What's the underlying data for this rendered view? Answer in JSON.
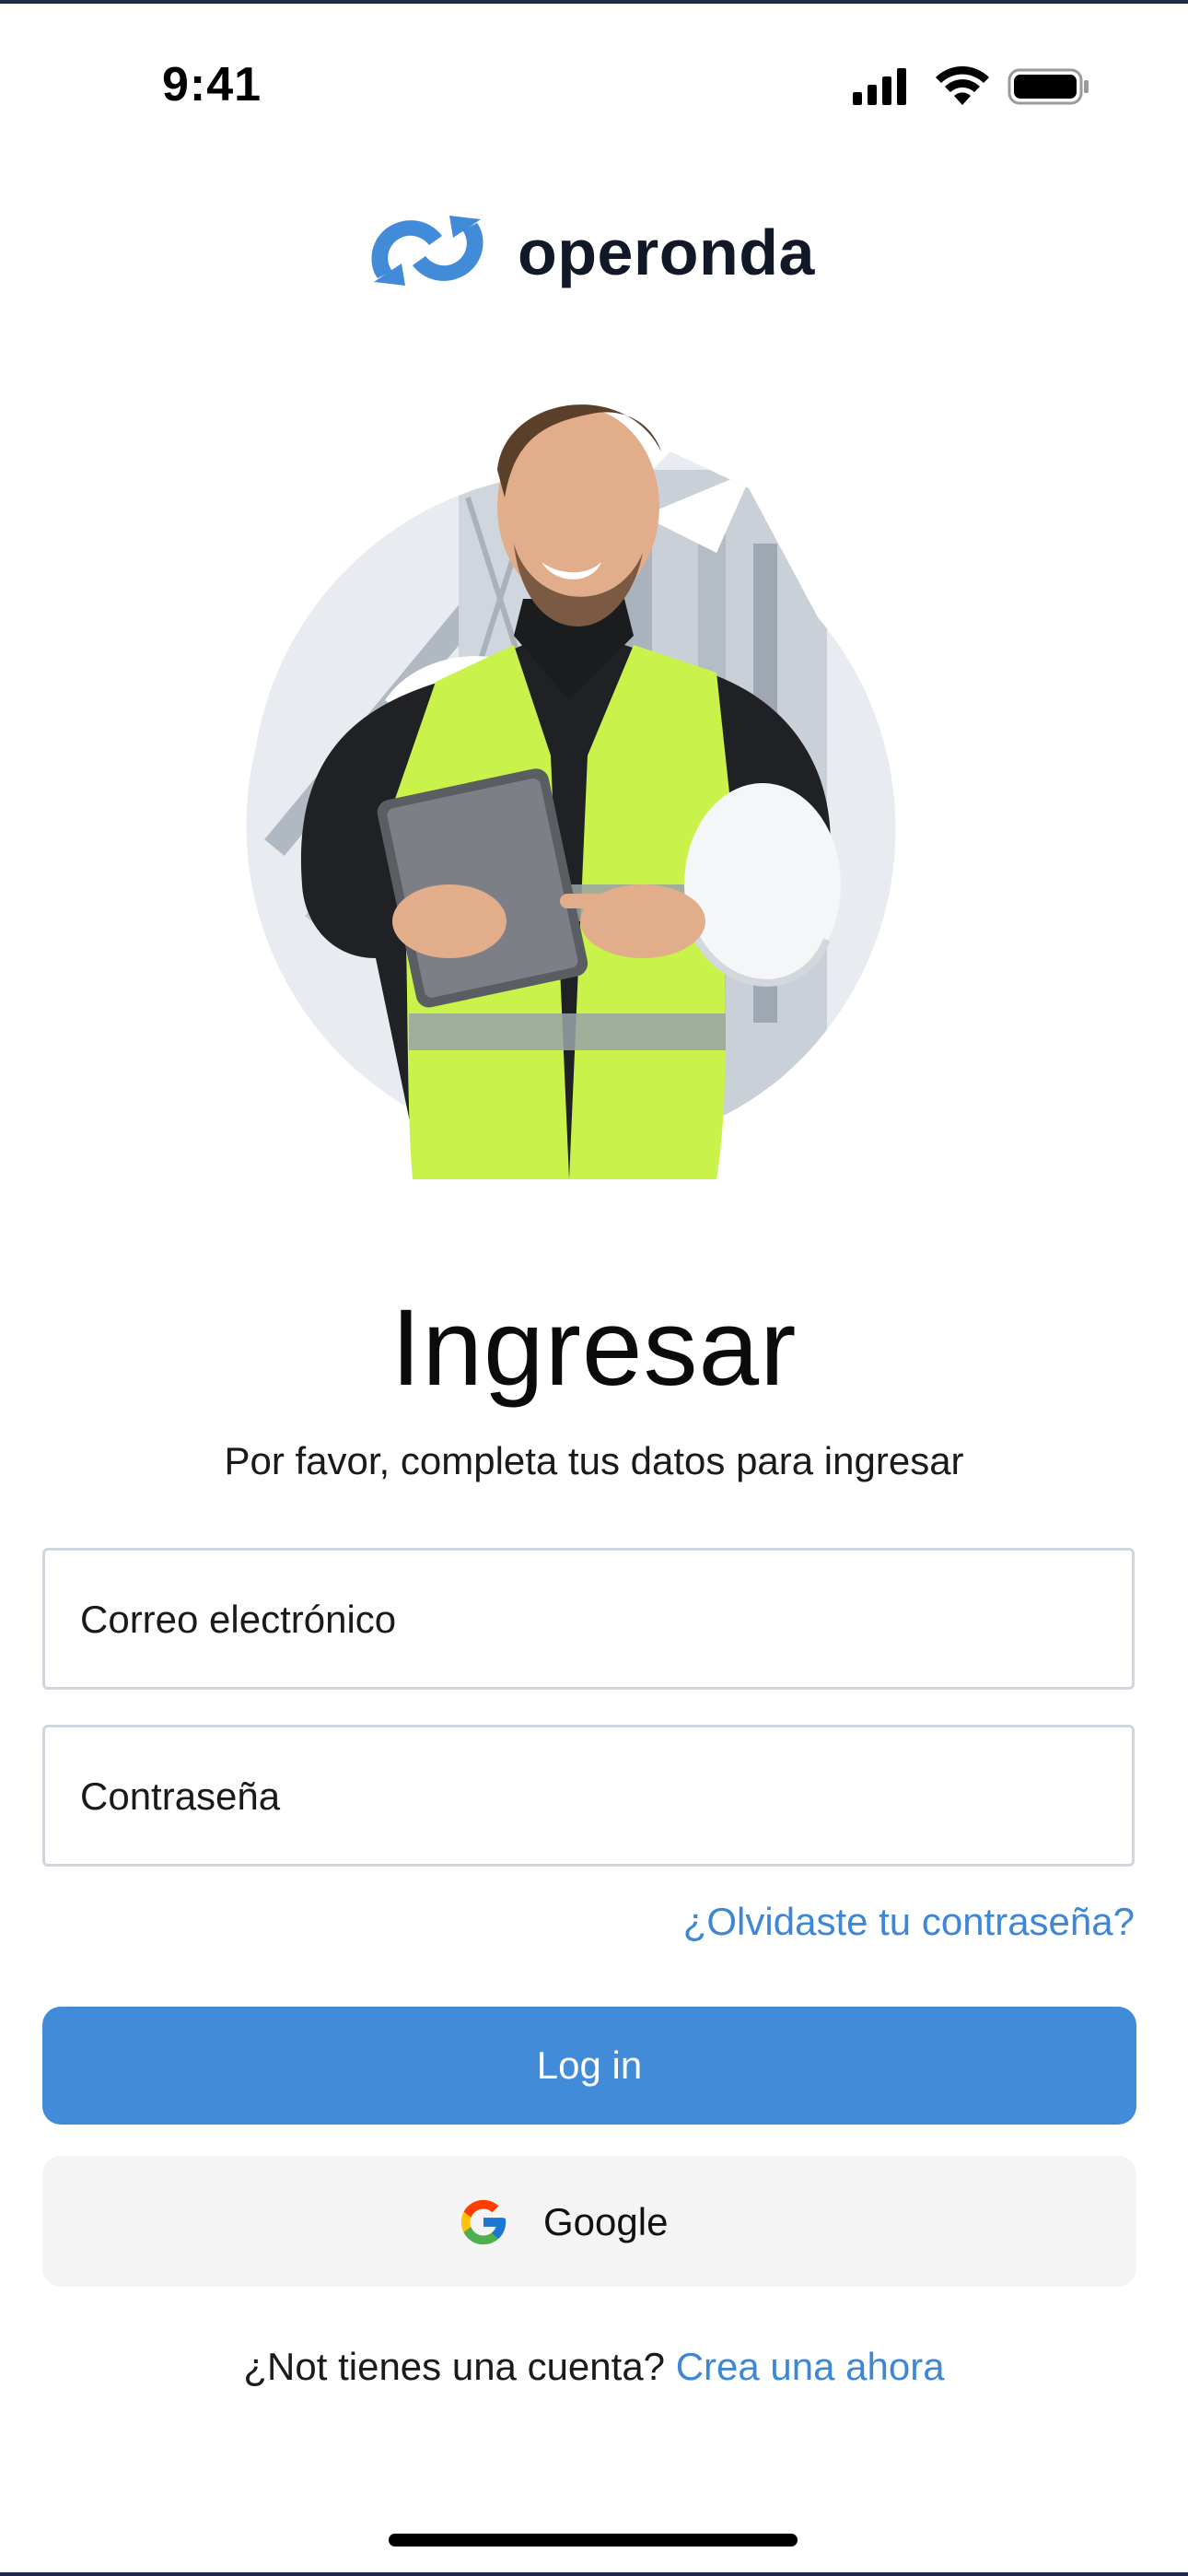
{
  "status_bar": {
    "time": "9:41",
    "icons": [
      "cellular-signal-icon",
      "wifi-icon",
      "battery-icon"
    ]
  },
  "brand": {
    "name": "operonda",
    "logo_icon": "operonda-logo-icon",
    "color": "#428bd8"
  },
  "hero": {
    "image_icon": "worker-with-tablet-illustration"
  },
  "login": {
    "title": "Ingresar",
    "subtitle": "Por favor, completa tus datos para ingresar",
    "email_placeholder": "Correo electrónico",
    "email_value": "",
    "password_placeholder": "Contraseña",
    "password_value": "",
    "forgot_password": "¿Olvidaste tu contraseña?",
    "login_button": "Log in",
    "google_button": "Google",
    "google_icon": "google-icon",
    "signup_prompt": "¿Not tienes una cuenta?",
    "signup_link": "Crea una ahora"
  },
  "colors": {
    "accent": "#428bd8",
    "link": "#3d87d6",
    "secondary_button": "#f4f4f5"
  }
}
